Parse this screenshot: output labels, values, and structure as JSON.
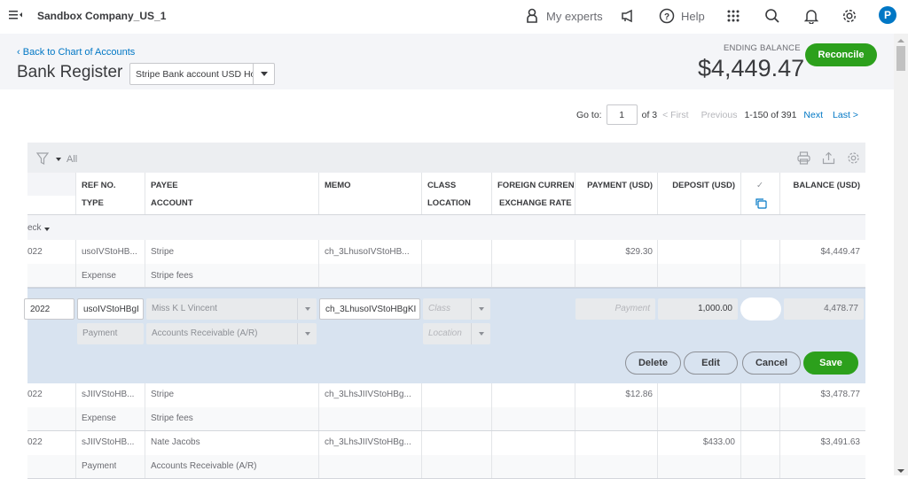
{
  "topnav": {
    "company": "Sandbox Company_US_1",
    "my_experts": "My experts",
    "help": "Help",
    "avatar_initial": "P"
  },
  "header": {
    "back_link": "Back to Chart of Accounts",
    "title": "Bank Register",
    "account_select": "Stripe Bank account USD Ho",
    "ending_balance_label": "ENDING BALANCE",
    "ending_balance": "$4,449.47",
    "reconcile_label": "Reconcile"
  },
  "pager": {
    "goto_label": "Go to:",
    "goto_value": "1",
    "of_pages": "of 3",
    "first": "< First",
    "previous": "Previous",
    "range": "1-150 of 391",
    "next": "Next",
    "last": "Last >"
  },
  "toolbar": {
    "filter_label": "All"
  },
  "columns": {
    "ref_no": "REF NO.",
    "type": "TYPE",
    "payee": "PAYEE",
    "account": "ACCOUNT",
    "memo": "MEMO",
    "class": "CLASS",
    "location": "LOCATION",
    "foreign_currency": "FOREIGN CURRENCY",
    "exchange_rate": "EXCHANGE RATE",
    "payment": "PAYMENT (USD)",
    "deposit": "DEPOSIT (USD)",
    "check": "✓",
    "balance": "BALANCE (USD)"
  },
  "group_label": "eck",
  "rows": [
    {
      "date": "022",
      "ref": "usoIVStoHB...",
      "type": "Expense",
      "payee": "Stripe",
      "account": "Stripe fees",
      "memo": "ch_3LhusoIVStoHB...",
      "payment": "$29.30",
      "deposit": "",
      "balance": "$4,449.47"
    },
    {
      "date": "022",
      "ref": "sJIIVStoHB...",
      "type": "Expense",
      "payee": "Stripe",
      "account": "Stripe fees",
      "memo": "ch_3LhsJIIVStoHBg...",
      "payment": "$12.86",
      "deposit": "",
      "balance": "$3,478.77"
    },
    {
      "date": "022",
      "ref": "sJIIVStoHB...",
      "type": "Payment",
      "payee": "Nate Jacobs",
      "account": "Accounts Receivable (A/R)",
      "memo": "ch_3LhsJIIVStoHBg...",
      "payment": "",
      "deposit": "$433.00",
      "balance": "$3,491.63"
    }
  ],
  "edit_row": {
    "date": "2022",
    "ref": "usoIVStoHBgI",
    "type": "Payment",
    "payee": "Miss K L Vincent",
    "account": "Accounts Receivable (A/R)",
    "memo": "ch_3LhusoIVStoHBgKI",
    "class_placeholder": "Class",
    "location_placeholder": "Location",
    "payment_placeholder": "Payment",
    "deposit": "1,000.00",
    "balance": "4,478.77",
    "delete_label": "Delete",
    "edit_label": "Edit",
    "cancel_label": "Cancel",
    "save_label": "Save"
  },
  "colors": {
    "brand_green": "#2ca01c",
    "link_blue": "#0077c5",
    "edit_row_bg": "#d8e3f0"
  }
}
